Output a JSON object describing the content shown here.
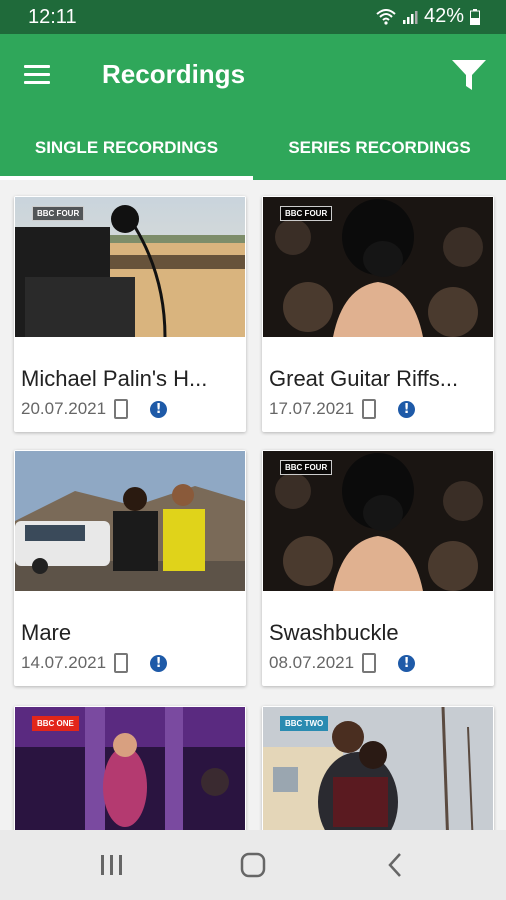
{
  "status_bar": {
    "time": "12:11",
    "battery": "42%"
  },
  "app_bar": {
    "title": "Recordings"
  },
  "tabs": [
    {
      "label": "SINGLE RECORDINGS",
      "active": true
    },
    {
      "label": "SERIES RECORDINGS",
      "active": false
    }
  ],
  "recordings": [
    {
      "title": "Michael Palin's H...",
      "date": "20.07.2021",
      "channel": "BBC FOUR"
    },
    {
      "title": "Great Guitar Riffs...",
      "date": "17.07.2021",
      "channel": "BBC FOUR"
    },
    {
      "title": "Mare",
      "date": "14.07.2021",
      "channel": ""
    },
    {
      "title": "Swashbuckle",
      "date": "08.07.2021",
      "channel": "BBC FOUR"
    },
    {
      "title": "",
      "date": "",
      "channel": "BBC ONE"
    },
    {
      "title": "",
      "date": "",
      "channel": "BBC TWO"
    }
  ],
  "colors": {
    "status_bar": "#1f6a3a",
    "primary": "#2fa75a",
    "info": "#1e5aa8"
  },
  "icons": {
    "menu": "menu-icon",
    "filter": "filter-icon",
    "device": "tablet-icon",
    "info": "info-icon"
  }
}
